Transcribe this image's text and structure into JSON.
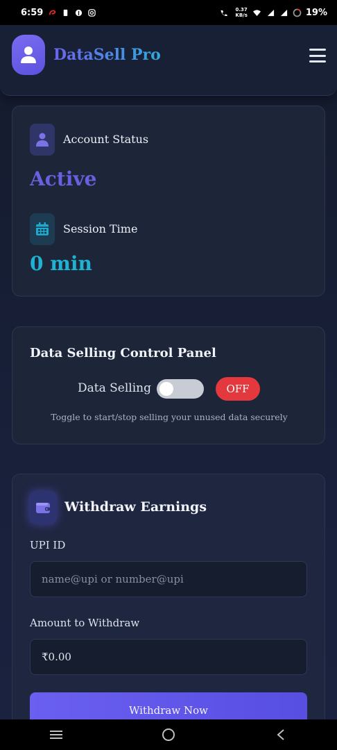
{
  "status_bar": {
    "time": "6:59",
    "net_speed_value": "0.37",
    "net_speed_unit": "KB/s",
    "battery": "19%"
  },
  "header": {
    "brand": "DataSell Pro"
  },
  "account": {
    "status_label": "Account Status",
    "status_value": "Active",
    "session_label": "Session Time",
    "session_value": "0 min"
  },
  "control_panel": {
    "title": "Data Selling Control Panel",
    "toggle_label": "Data Selling",
    "toggle_state": "OFF",
    "hint": "Toggle to start/stop selling your unused data securely"
  },
  "withdraw": {
    "title": "Withdraw Earnings",
    "upi_label": "UPI ID",
    "upi_placeholder": "name@upi or number@upi",
    "amount_label": "Amount to Withdraw",
    "amount_value": "₹0.00",
    "button_label": "Withdraw Now"
  },
  "colors": {
    "accent": "#6a60df",
    "session_accent": "#1fb2d2",
    "off_badge": "#e4383f"
  }
}
